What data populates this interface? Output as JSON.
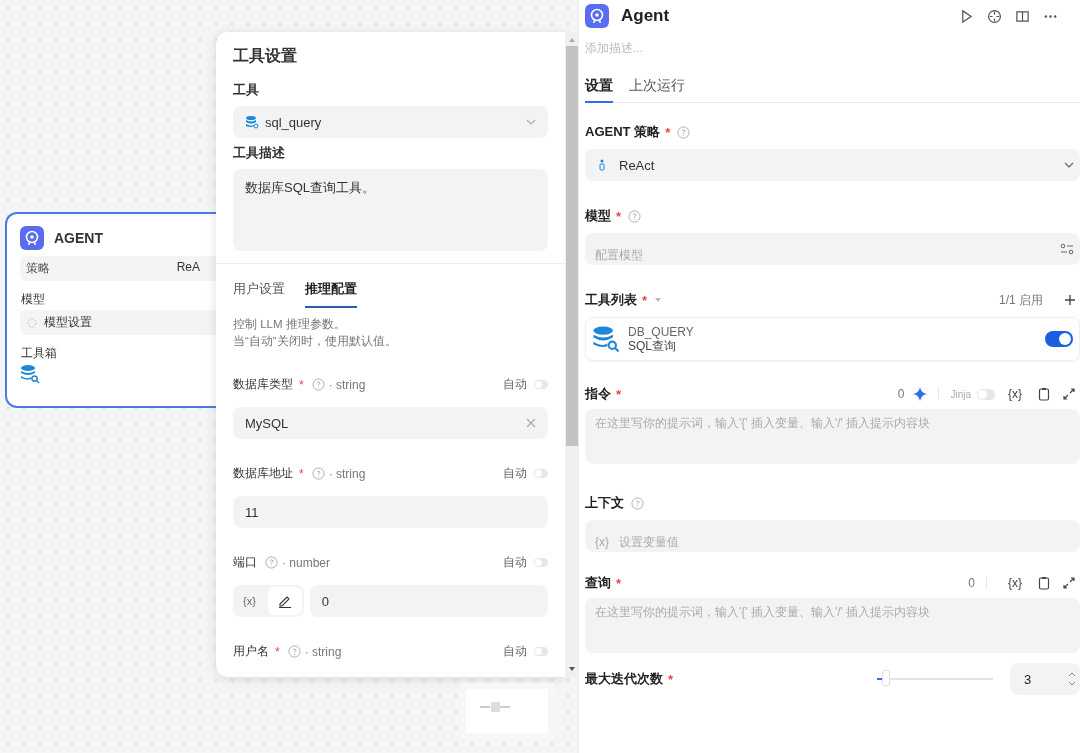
{
  "node": {
    "title": "AGENT",
    "strategy_label": "策略",
    "strategy_value": "ReA",
    "model_label": "模型",
    "model_value": "模型设置",
    "toolbox_label": "工具箱"
  },
  "tool_popup": {
    "title": "工具设置",
    "tool_label": "工具",
    "tool_value": "sql_query",
    "desc_label": "工具描述",
    "desc_value": "数据库SQL查询工具。",
    "tabs": [
      {
        "label": "用户设置",
        "selected": false
      },
      {
        "label": "推理配置",
        "selected": true
      }
    ],
    "hint_lines": [
      "控制 LLM 推理参数。",
      "当“自动”关闭时，使用默认值。"
    ],
    "params": [
      {
        "kind": "text",
        "name": "数据库类型",
        "required_mark": "*",
        "type": "· string",
        "auto_label": "自动",
        "auto": false,
        "value": "MySQL",
        "clearable": true
      },
      {
        "kind": "text",
        "name": "数据库地址",
        "required_mark": "*",
        "type": "· string",
        "auto_label": "自动",
        "auto": false,
        "value": "11",
        "clearable": false
      },
      {
        "kind": "variable",
        "name": "端口",
        "type": "· number",
        "auto_label": "自动",
        "auto": false,
        "var_label": "{x}",
        "value": "0"
      },
      {
        "kind": "header",
        "name": "用户名",
        "required_mark": "*",
        "type": "· string",
        "auto_label": "自动",
        "auto": false
      }
    ]
  },
  "panel": {
    "title": "Agent",
    "description_placeholder": "添加描述...",
    "tabs": [
      {
        "label": "设置",
        "selected": true
      },
      {
        "label": "上次运行",
        "selected": false
      }
    ],
    "strategy": {
      "label": "AGENT 策略",
      "required_mark": "*",
      "value": "ReAct"
    },
    "model": {
      "label": "模型",
      "required_mark": "*",
      "placeholder": "配置模型"
    },
    "tools": {
      "label": "工具列表",
      "required_mark": "*",
      "count": "1/1 启用",
      "items": [
        {
          "name": "DB_QUERY",
          "subtitle": "SQL查询",
          "enabled": true
        }
      ]
    },
    "instruction": {
      "label": "指令",
      "required_mark": "*",
      "count": "0",
      "jinja_label": "Jinja",
      "jinja": false,
      "var_label": "{x}",
      "placeholder": "在这里写你的提示词，输入'{' 插入变量、输入'/' 插入提示内容块"
    },
    "context": {
      "label": "上下文",
      "var_label": "{x}",
      "placeholder": "设置变量值"
    },
    "query": {
      "label": "查询",
      "required_mark": "*",
      "count": "0",
      "var_label": "{x}",
      "placeholder": "在这里写你的提示词，输入'{' 插入变量、输入'/' 插入提示内容块"
    },
    "max_iterations": {
      "label": "最大迭代次数",
      "required_mark": "*",
      "level": 0.05,
      "value": "3"
    }
  }
}
